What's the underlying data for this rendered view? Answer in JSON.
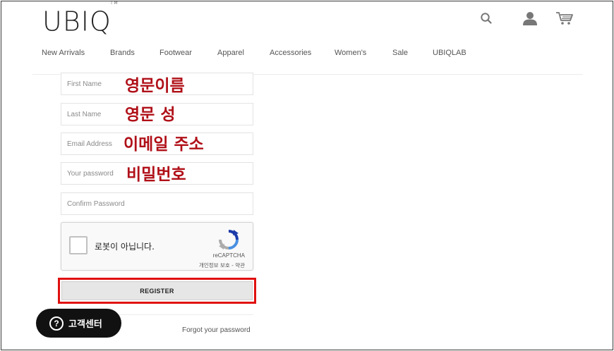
{
  "header": {
    "logo_text": "UBIQ",
    "logo_mark": "TM",
    "icons": [
      "search-icon",
      "user-icon",
      "cart-icon"
    ]
  },
  "nav": {
    "items": [
      "New Arrivals",
      "Brands",
      "Footwear",
      "Apparel",
      "Accessories",
      "Women's",
      "Sale",
      "UBIQLAB"
    ]
  },
  "form": {
    "first_name_placeholder": "First Name",
    "last_name_placeholder": "Last Name",
    "email_placeholder": "Email Address",
    "password_placeholder": "Your password",
    "confirm_placeholder": "Confirm Password",
    "register_label": "REGISTER",
    "forgot_label": "Forgot your password"
  },
  "annotations": {
    "first_name": "영문이름",
    "last_name": "영문 성",
    "email": "이메일 주소",
    "password": "비밀번호",
    "color": "#b01018"
  },
  "recaptcha": {
    "label": "로봇이 아닙니다.",
    "brand": "reCAPTCHA",
    "terms": "개인정보 보호 - 약관"
  },
  "support": {
    "icon": "question-icon",
    "label": "고객센터"
  },
  "colors": {
    "highlight": "#e01010",
    "support_bg": "#111111"
  }
}
